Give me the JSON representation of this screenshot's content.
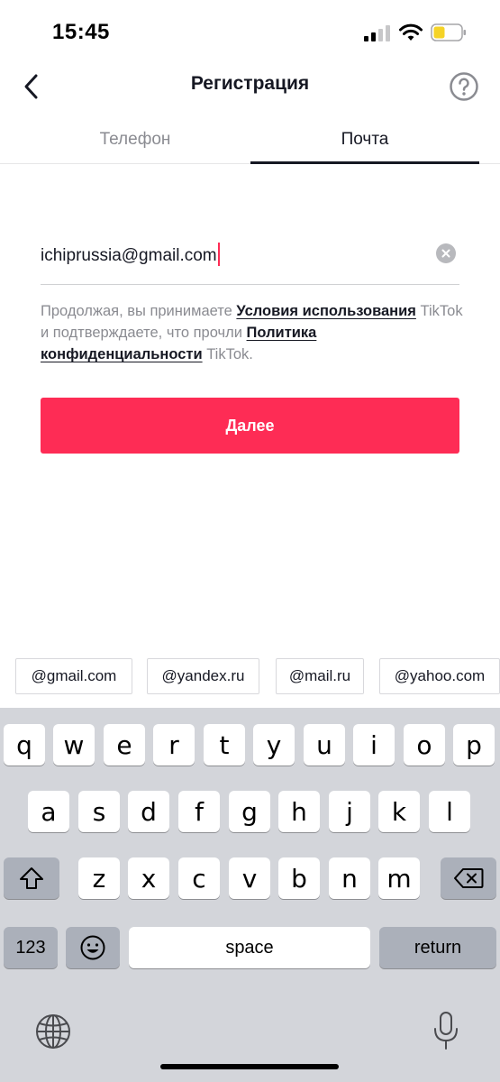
{
  "status": {
    "time": "15:45"
  },
  "header": {
    "title": "Регистрация"
  },
  "tabs": [
    {
      "label": "Телефон",
      "active": false
    },
    {
      "label": "Почта",
      "active": true
    }
  ],
  "form": {
    "email_value": "ichiprussia@gmail.com",
    "terms_before": "Продолжая, вы принимаете ",
    "terms_link": "Условия использования",
    "terms_middle": " TikTok и подтверждаете, что прочли ",
    "privacy_link": "Политика конфиденциальности",
    "terms_after": " TikTok.",
    "next_label": "Далее"
  },
  "suggestions": [
    "@gmail.com",
    "@yandex.ru",
    "@mail.ru",
    "@yahoo.com"
  ],
  "keyboard": {
    "row1": [
      "q",
      "w",
      "e",
      "r",
      "t",
      "y",
      "u",
      "i",
      "o",
      "p"
    ],
    "row2": [
      "a",
      "s",
      "d",
      "f",
      "g",
      "h",
      "j",
      "k",
      "l"
    ],
    "row3": [
      "z",
      "x",
      "c",
      "v",
      "b",
      "n",
      "m"
    ],
    "numbers_label": "123",
    "space_label": "space",
    "return_label": "return"
  },
  "colors": {
    "accent": "#fe2c55",
    "text": "#161823",
    "muted": "#8a8b91",
    "keyboard_bg": "#d3d5da"
  },
  "icons": [
    "back-arrow-icon",
    "help-icon",
    "clear-icon",
    "shift-icon",
    "backspace-icon",
    "emoji-icon",
    "globe-icon",
    "microphone-icon",
    "signal-icon",
    "wifi-icon",
    "battery-icon"
  ]
}
